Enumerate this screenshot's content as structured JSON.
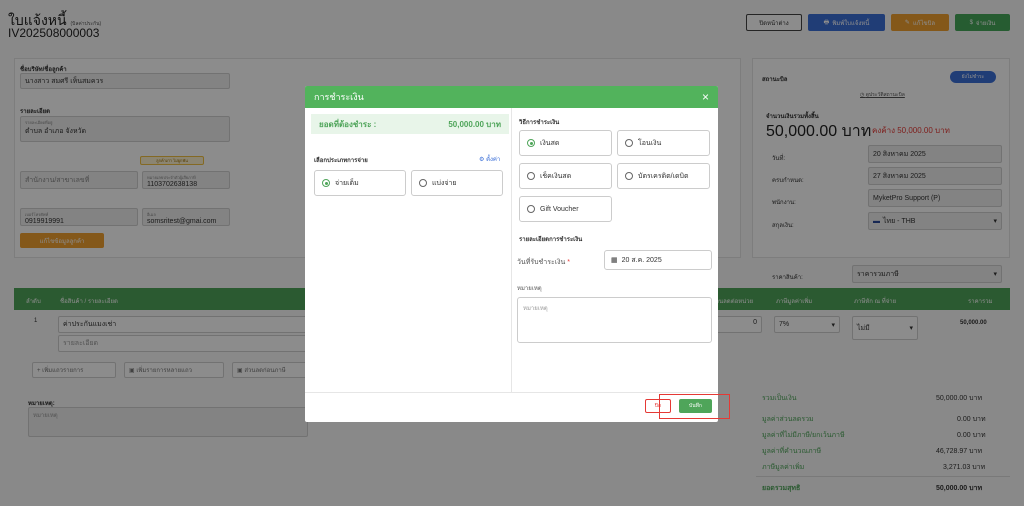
{
  "header": {
    "title": "ใบแจ้งหนี้",
    "title_note": "(บิลค่าประกัน)",
    "doc_no": "IV202508000003",
    "buttons": {
      "close": "ปิดหน้าต่าง",
      "print": "พิมพ์ใบแจ้งหนี้",
      "edit": "แก้ไขบิล",
      "pay": "จ่ายเงิน"
    }
  },
  "customer": {
    "company_label": "ชื่อบริษัท/ชื่อลูกค้า",
    "company_value": "นางสาว สมศรี เห็นสมควร",
    "detail_label": "รายละเอียด",
    "address_tiny": "รายละเอียดที่อยู่",
    "address_value": "ตำบล อำเภอ จังหวัด",
    "badge": "ลูกค้าเก่า ไม่ผูกพัน",
    "branch_placeholder": "สำนักงาน/สาขาเลขที่",
    "tax_tiny": "หมายเลขประจำตัวผู้เสียภาษี",
    "tax_value": "1103702638138",
    "phone_tiny": "เบอร์โทรศัพท์",
    "phone_value": "0919919991",
    "email_tiny": "อีเมล",
    "email_value": "somsritest@gmai.com",
    "edit_button": "แก้ไขข้อมูลลูกค้า"
  },
  "status_panel": {
    "status_label": "สถานะบิล",
    "status_badge": "ยังไม่ชำระ",
    "history_link": "ดูประวัติสถานะบิล",
    "total_label": "จำนวนเงินรวมทั้งสิ้น",
    "total_value": "50,000.00 บาท",
    "outstanding": "คงค้าง 50,000.00 บาท",
    "rows": [
      {
        "label": "วันที่:",
        "value": "20 สิงหาคม 2025"
      },
      {
        "label": "ครบกำหนด:",
        "value": "27 สิงหาคม 2025"
      },
      {
        "label": "พนักงาน:",
        "value": "MyketPro Support (P)"
      },
      {
        "label": "สกุลเงิน:",
        "value": "ไทย - THB"
      }
    ],
    "price_type_label": "ราคาสินค้า:",
    "price_type_value": "ราคารวมภาษี"
  },
  "table": {
    "headers": [
      "ลำดับ",
      "ชื่อสินค้า / รายละเอียด",
      "ส่วนลดต่อหน่วย",
      "ภาษีมูลค่าเพิ่ม",
      "ภาษีหัก ณ ที่จ่าย",
      "ราคารวม"
    ],
    "row": {
      "no": "1",
      "name": "ค่าประกันแมงเช่า",
      "detail_placeholder": "รายละเอียด",
      "discount": "0",
      "vat": "7%",
      "wht": "ไม่มี",
      "total": "50,000.00"
    },
    "add_buttons": [
      "เพิ่มแถวรายการ",
      "เพิ่มรายการหลายแถว",
      "ส่วนลดก่อนภาษี"
    ]
  },
  "note": {
    "label": "หมายเหตุ:",
    "placeholder": "หมายเหตุ"
  },
  "totals": [
    {
      "label": "รวมเป็นเงิน",
      "value": "50,000.00 บาท"
    },
    {
      "label": "มูลค่าส่วนลดรวม",
      "value": "0.00 บาท"
    },
    {
      "label": "มูลค่าที่ไม่มีภาษี/ยกเว้นภาษี",
      "value": "0.00 บาท"
    },
    {
      "label": "มูลค่าที่คำนวณภาษี",
      "value": "46,728.97 บาท"
    },
    {
      "label": "ภาษีมูลค่าเพิ่ม",
      "value": "3,271.03 บาท"
    },
    {
      "label": "ยอดรวมสุทธิ",
      "value": "50,000.00 บาท"
    }
  ],
  "modal": {
    "title": "การชำระเงิน",
    "due_label": "ยอดที่ต้องชำระ :",
    "due_value": "50,000.00 บาท",
    "payment_type_label": "เลือกประเภทการจ่าย",
    "settings_link": "ตั้งค่า",
    "payment_types": [
      {
        "label": "จ่ายเต็ม",
        "selected": true
      },
      {
        "label": "แบ่งจ่าย",
        "selected": false
      }
    ],
    "method_label": "วิธีการชำระเงิน",
    "methods": [
      {
        "label": "เงินสด",
        "selected": true
      },
      {
        "label": "โอนเงิน",
        "selected": false
      },
      {
        "label": "เช็คเงินสด",
        "selected": false
      },
      {
        "label": "บัตรเครดิต/เดบิต",
        "selected": false
      },
      {
        "label": "Gift Voucher",
        "selected": false
      }
    ],
    "detail_label": "รายละเอียดการชำระเงิน",
    "date_label": "วันที่รับชำระเงิน",
    "date_value": "20 ส.ค. 2025",
    "note_label": "หมายเหตุ",
    "note_placeholder": "หมายเหตุ",
    "cancel_button": "ปิด",
    "save_button": "บันทึก"
  },
  "colors": {
    "accent_green": "#4fa55a",
    "highlight_red": "#e53935"
  }
}
